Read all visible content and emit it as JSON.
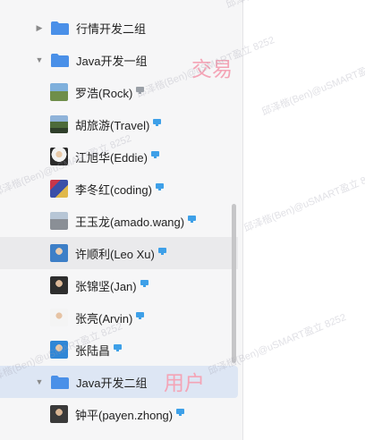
{
  "tree": {
    "items": [
      {
        "type": "group",
        "label": "行情开发二组",
        "expanded": false
      },
      {
        "type": "group",
        "label": "Java开发一组",
        "expanded": true
      },
      {
        "type": "user",
        "label": "罗浩(Rock)",
        "device": "offline",
        "avatar": "landscape-photo"
      },
      {
        "type": "user",
        "label": "胡旅游(Travel)",
        "device": "online",
        "avatar": "outdoor-photo"
      },
      {
        "type": "user",
        "label": "江旭华(Eddie)",
        "device": "online",
        "avatar": "portrait-photo"
      },
      {
        "type": "user",
        "label": "李冬红(coding)",
        "device": "online",
        "avatar": "colorful-photo"
      },
      {
        "type": "user",
        "label": "王玉龙(amado.wang)",
        "device": "online",
        "avatar": "group-photo"
      },
      {
        "type": "user",
        "label": "许顺利(Leo Xu)",
        "device": "online",
        "avatar": "portrait-photo"
      },
      {
        "type": "user",
        "label": "张锦坚(Jan)",
        "device": "online",
        "avatar": "portrait-photo"
      },
      {
        "type": "user",
        "label": "张亮(Arvin)",
        "device": "online",
        "avatar": "portrait-photo"
      },
      {
        "type": "user",
        "label": "张陆昌",
        "device": "online",
        "avatar": "portrait-photo"
      },
      {
        "type": "group",
        "label": "Java开发二组",
        "expanded": true
      },
      {
        "type": "user",
        "label": "钟平(payen.zhong)",
        "device": "online",
        "avatar": "portrait-photo"
      }
    ]
  },
  "annotations": {
    "trade": "交易",
    "user": "用户"
  },
  "watermark": "邱泽楷(Ben)@uSMART盈立 8252",
  "colors": {
    "folder": "#4a90e8",
    "device_online": "#3ea0e8",
    "device_offline": "#9aa0a6",
    "selected_row": "#dde6f4",
    "annotation": "#f4a4b6"
  }
}
